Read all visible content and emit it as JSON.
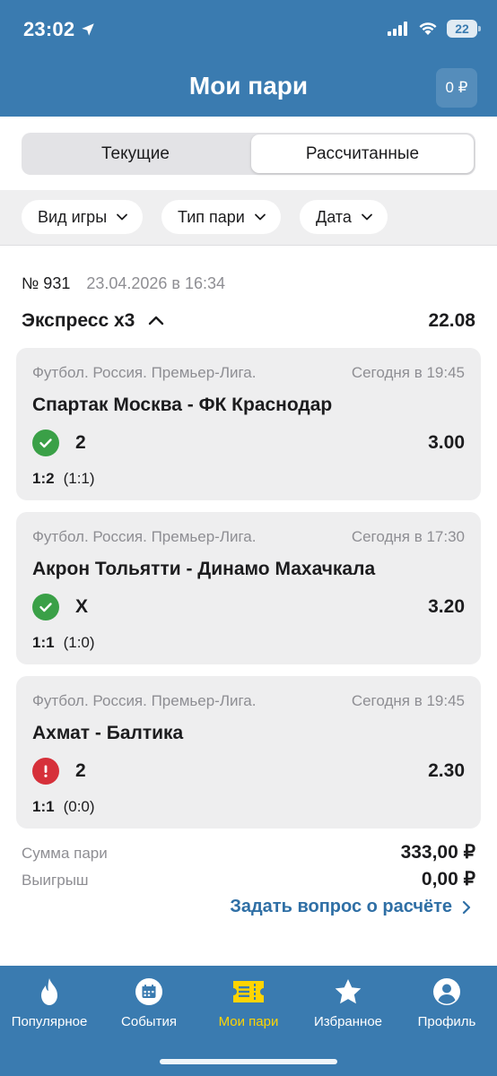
{
  "status_bar": {
    "time": "23:02",
    "battery": "22"
  },
  "header": {
    "title": "Мои пари",
    "balance": "0 ₽"
  },
  "tabs_segment": {
    "current": "Текущие",
    "settled": "Рассчитанные"
  },
  "filters": [
    {
      "label": "Вид игры"
    },
    {
      "label": "Тип пари"
    },
    {
      "label": "Дата"
    }
  ],
  "bet": {
    "number": "№ 931",
    "date": "23.04.2026 в 16:34",
    "type": "Экспресс х3",
    "total_odds": "22.08",
    "events": [
      {
        "league": "Футбол. Россия. Премьер-Лига.",
        "time": "Сегодня в 19:45",
        "teams": "Спартак Москва - ФК Краснодар",
        "pick": "2",
        "odds": "3.00",
        "score": "1:2",
        "half_score": "(1:1)",
        "status": "win"
      },
      {
        "league": "Футбол. Россия. Премьер-Лига.",
        "time": "Сегодня в 17:30",
        "teams": "Акрон Тольятти - Динамо Махачкала",
        "pick": "X",
        "odds": "3.20",
        "score": "1:1",
        "half_score": "(1:0)",
        "status": "win"
      },
      {
        "league": "Футбол. Россия. Премьер-Лига.",
        "time": "Сегодня в 19:45",
        "teams": "Ахмат - Балтика",
        "pick": "2",
        "odds": "2.30",
        "score": "1:1",
        "half_score": "(0:0)",
        "status": "lose"
      }
    ],
    "stake_label": "Сумма пари",
    "stake_value": "333,00 ₽",
    "win_label": "Выигрыш",
    "win_value": "0,00 ₽",
    "ask_link": "Задать вопрос о расчёте"
  },
  "tab_bar": [
    {
      "label": "Популярное",
      "icon": "flame-icon"
    },
    {
      "label": "События",
      "icon": "calendar-icon"
    },
    {
      "label": "Мои пари",
      "icon": "ticket-icon",
      "active": true
    },
    {
      "label": "Избранное",
      "icon": "star-icon"
    },
    {
      "label": "Профиль",
      "icon": "profile-icon"
    }
  ],
  "colors": {
    "brand": "#3a7bb0",
    "win": "#3aa047",
    "lose": "#d6303a",
    "active_tab": "#ffd400",
    "link": "#2f6fa5"
  }
}
